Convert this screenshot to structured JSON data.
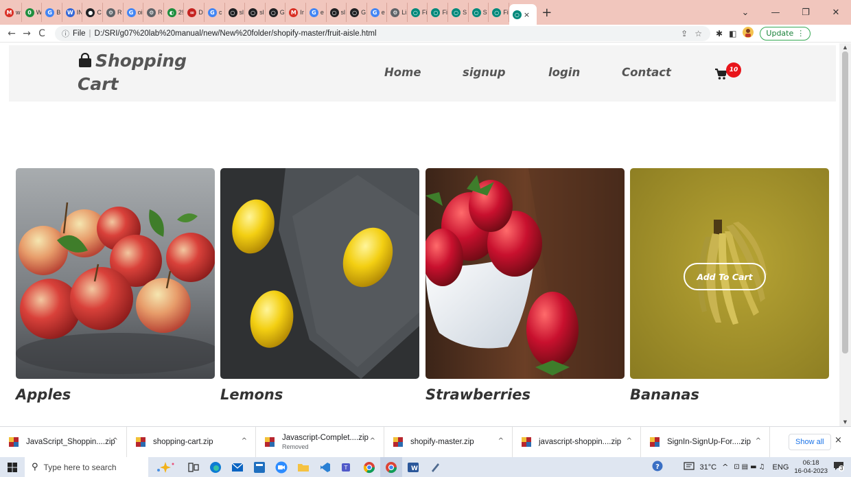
{
  "browser": {
    "tabs": [
      {
        "label": "w",
        "favicon": "M",
        "color": "#d93025"
      },
      {
        "label": "W",
        "favicon": "0",
        "color": "#1e8e3e"
      },
      {
        "label": "B",
        "favicon": "G",
        "color": "#4285f4"
      },
      {
        "label": "IN",
        "favicon": "W",
        "color": "#3367d6"
      },
      {
        "label": "C",
        "favicon": "●",
        "color": "#202124"
      },
      {
        "label": "R",
        "favicon": "⚙",
        "color": "#5f6368"
      },
      {
        "label": "oi",
        "favicon": "G",
        "color": "#4285f4"
      },
      {
        "label": "R",
        "favicon": "⚙",
        "color": "#5f6368"
      },
      {
        "label": "2!",
        "favicon": "◐",
        "color": "#1e8e3e"
      },
      {
        "label": "D",
        "favicon": "∞",
        "color": "#c5221f"
      },
      {
        "label": "c",
        "favicon": "G",
        "color": "#4285f4"
      },
      {
        "label": "sl",
        "favicon": "○",
        "color": "#202124"
      },
      {
        "label": "sl",
        "favicon": "○",
        "color": "#202124"
      },
      {
        "label": "G",
        "favicon": "○",
        "color": "#202124"
      },
      {
        "label": "Ir",
        "favicon": "M",
        "color": "#d93025"
      },
      {
        "label": "e",
        "favicon": "G",
        "color": "#4285f4"
      },
      {
        "label": "sl",
        "favicon": "○",
        "color": "#202124"
      },
      {
        "label": "G",
        "favicon": "○",
        "color": "#202124"
      },
      {
        "label": "e",
        "favicon": "G",
        "color": "#4285f4"
      },
      {
        "label": "Li",
        "favicon": "⚙",
        "color": "#5f6368"
      },
      {
        "label": "Fi",
        "favicon": "○",
        "color": "#00897b"
      },
      {
        "label": "Fi",
        "favicon": "○",
        "color": "#00897b"
      },
      {
        "label": "S",
        "favicon": "○",
        "color": "#00897b"
      },
      {
        "label": "S",
        "favicon": "○",
        "color": "#00897b"
      },
      {
        "label": "Fi",
        "favicon": "○",
        "color": "#00897b"
      }
    ],
    "active_tab_favicon": "○",
    "active_tab_close": "×",
    "new_tab": "+",
    "window_controls": {
      "dropdown": "⌄",
      "minimize": "—",
      "restore": "❐",
      "close": "✕"
    },
    "nav": {
      "back": "←",
      "forward": "→",
      "reload": "C"
    },
    "address": {
      "info_icon": "ⓘ",
      "scheme": "File",
      "url": "D:/SRI/g07%20lab%20manual/new/New%20folder/shopify-master/fruit-aisle.html"
    },
    "omnibox_icons": {
      "share": "⇪",
      "star": "☆"
    },
    "extensions": {
      "puzzle": "✱",
      "sidepanel": "◧"
    },
    "update_label": "Update",
    "update_menu": "⋮"
  },
  "site": {
    "brand_line1": "Shopping",
    "brand_line2": "Cart",
    "nav": [
      "Home",
      "signup",
      "login",
      "Contact"
    ],
    "cart_count": "10"
  },
  "products": [
    {
      "name": "Apples"
    },
    {
      "name": "Lemons"
    },
    {
      "name": "Strawberries"
    },
    {
      "name": "Bananas",
      "button": "Add To Cart"
    }
  ],
  "downloads": {
    "items": [
      {
        "name": "JavaScript_Shoppin....zip",
        "chev": "^"
      },
      {
        "name": "shopping-cart.zip",
        "chev": "^"
      },
      {
        "name": "Javascript-Complet....zip",
        "status": "Removed",
        "chev": "^"
      },
      {
        "name": "shopify-master.zip",
        "chev": "^"
      },
      {
        "name": "javascript-shoppin....zip",
        "chev": "^"
      },
      {
        "name": "SignIn-SignUp-For....zip",
        "chev": "^"
      }
    ],
    "show_all": "Show all",
    "close": "×"
  },
  "taskbar": {
    "search_placeholder": "Type here to search",
    "weather": "31°C",
    "lang": "ENG",
    "time": "06:18",
    "date": "16-04-2023",
    "notifications": "3"
  },
  "colors": {
    "tabstrip": "#f1c6bd",
    "header_bg": "#f4f4f4",
    "cart_badge": "#e8151b",
    "text_dark": "#333333"
  }
}
